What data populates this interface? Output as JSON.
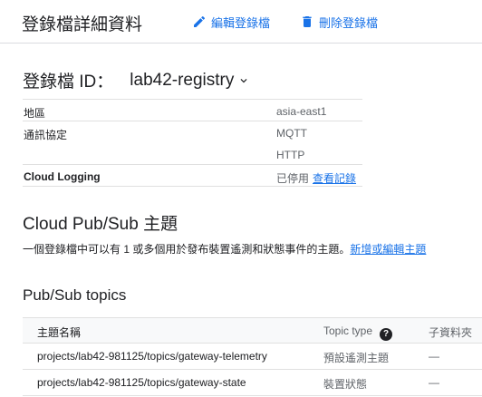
{
  "header": {
    "title": "登錄檔詳細資料",
    "edit_label": "編輯登錄檔",
    "delete_label": "刪除登錄檔"
  },
  "registry": {
    "label": "登錄檔 ID：",
    "id": "lab42-registry"
  },
  "details": {
    "region_key": "地區",
    "region_value": "asia-east1",
    "protocol_key": "通訊協定",
    "protocols": [
      "MQTT",
      "HTTP"
    ],
    "logging_key": "Cloud Logging",
    "logging_status": "已停用",
    "logging_link": "查看記錄"
  },
  "pubsub": {
    "heading": "Cloud Pub/Sub 主題",
    "description": "一個登錄檔中可以有 1 或多個用於發布裝置遙測和狀態事件的主題。",
    "link": "新增或編輯主題"
  },
  "topics": {
    "heading": "Pub/Sub topics",
    "columns": [
      "主題名稱",
      "Topic type",
      "子資料夾"
    ],
    "rows": [
      [
        "projects/lab42-981125/topics/gateway-telemetry",
        "預設遙測主題",
        "—"
      ],
      [
        "projects/lab42-981125/topics/gateway-state",
        "裝置狀態",
        "—"
      ]
    ]
  },
  "colors": {
    "accent": "#1a73e8",
    "text": "#202124",
    "secondary": "#5f6368",
    "divider": "#e0e0e0"
  },
  "icons": [
    "pencil-icon",
    "trash-icon",
    "chevron-down-icon",
    "help-icon"
  ]
}
